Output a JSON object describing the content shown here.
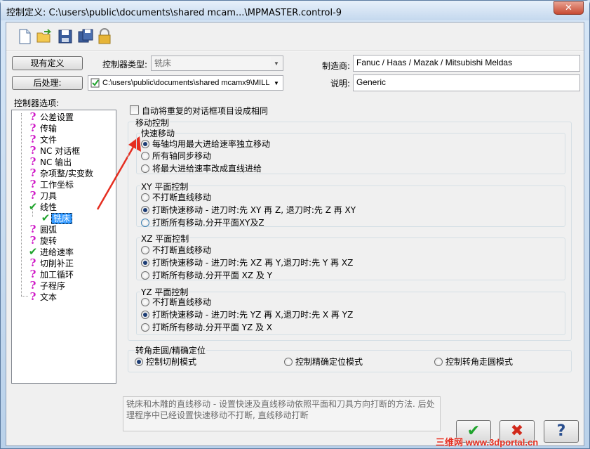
{
  "window": {
    "title": "控制定义: C:\\users\\public\\documents\\shared mcam...\\MPMASTER.control-9",
    "close": "✕"
  },
  "toolbar": {
    "icons": [
      "new-file-icon",
      "open-folder-icon",
      "save-icon",
      "save-as-icon",
      "lock-icon"
    ]
  },
  "header": {
    "current_def_button": "现有定义",
    "post_button": "后处理:",
    "controller_type_label": "控制器类型:",
    "controller_type_value": "铣床",
    "post_path": "C:\\users\\public\\documents\\shared mcamx9\\MILL",
    "manufacturer_label": "制造商:",
    "manufacturer_value": "Fanuc / Haas / Mazak / Mitsubishi Meldas",
    "description_label": "说明:",
    "description_value": "Generic"
  },
  "tree": {
    "label": "控制器选项:",
    "items": [
      {
        "label": "公差设置",
        "status": "?"
      },
      {
        "label": "传输",
        "status": "?"
      },
      {
        "label": "文件",
        "status": "?"
      },
      {
        "label": "NC 对话框",
        "status": "?"
      },
      {
        "label": "NC 输出",
        "status": "?"
      },
      {
        "label": "杂项整/实变数",
        "status": "?"
      },
      {
        "label": "工作坐标",
        "status": "?"
      },
      {
        "label": "刀具",
        "status": "?"
      },
      {
        "label": "线性",
        "status": "✔"
      },
      {
        "label": "铣床",
        "status": "✔"
      },
      {
        "label": "圆弧",
        "status": "?"
      },
      {
        "label": "旋转",
        "status": "?"
      },
      {
        "label": "进给速率",
        "status": "✔"
      },
      {
        "label": "切削补正",
        "status": "?"
      },
      {
        "label": "加工循环",
        "status": "?"
      },
      {
        "label": "子程序",
        "status": "?"
      },
      {
        "label": "文本",
        "status": "?"
      }
    ]
  },
  "panel": {
    "auto_same_checkbox": "自动将重复的对话框项目设成相同",
    "motion_group": "移动控制",
    "rapid": {
      "title": "快速移动",
      "options": [
        "每轴均用最大进给速率独立移动",
        "所有轴同步移动",
        "将最大进给速率改成直线进给"
      ]
    },
    "xy": {
      "title": "XY 平面控制",
      "options": [
        "不打断直线移动",
        "打断快速移动 - 进刀时:先 XY 再 Z, 退刀时:先 Z 再 XY",
        "打断所有移动.分开平面XY及Z"
      ]
    },
    "xz": {
      "title": "XZ 平面控制",
      "options": [
        "不打断直线移动",
        "打断快速移动 - 进刀时:先 XZ 再 Y,退刀时:先 Y 再 XZ",
        "打断所有移动.分开平面 XZ 及 Y"
      ]
    },
    "yz": {
      "title": "YZ 平面控制",
      "options": [
        "不打断直线移动",
        "打断快速移动 - 进刀时:先 YZ 再 X,退刀时:先 X 再 YZ",
        "打断所有移动.分开平面 YZ 及 X"
      ]
    },
    "corner": {
      "title": "转角走圆/精确定位",
      "options": [
        "控制切削模式",
        "控制精确定位模式",
        "控制转角走圆模式"
      ]
    }
  },
  "description_text": "铣床和木雕的直线移动 - 设置快速及直线移动依照平面和刀具方向打断的方法. 后处理程序中已经设置快速移动不打断, 直线移动打断",
  "buttons": {
    "ok": "✔",
    "cancel": "✖",
    "help": "?"
  },
  "watermark": "三维网 www.3dportal.cn",
  "colors": {
    "accent_red": "#e52e20",
    "check_green": "#1fa32c",
    "question_magenta": "#d01ec8"
  }
}
